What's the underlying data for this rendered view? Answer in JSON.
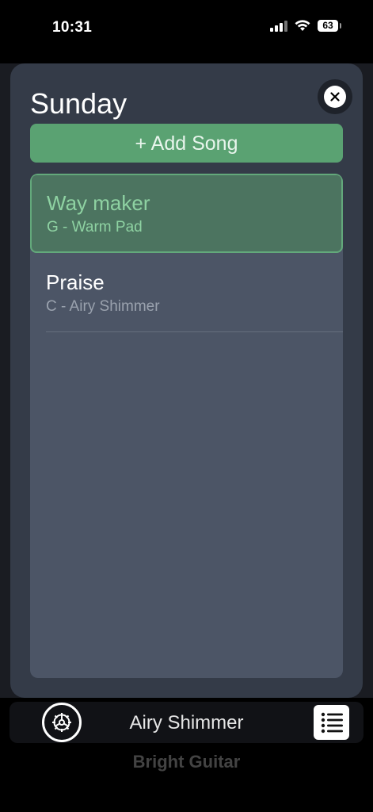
{
  "status_bar": {
    "time": "10:31",
    "battery": "63"
  },
  "sheet": {
    "title": "Sunday",
    "add_song_label": "+ Add Song",
    "songs": [
      {
        "name": "Way maker",
        "detail": "G - Warm Pad",
        "selected": true
      },
      {
        "name": "Praise",
        "detail": "C - Airy Shimmer",
        "selected": false
      }
    ]
  },
  "bottom_bar": {
    "current_patch": "Airy Shimmer",
    "next_patch": "Bright Guitar"
  },
  "icons": {
    "close": "close-icon",
    "settings": "gear-icon",
    "list": "list-icon",
    "signal": "signal-icon",
    "wifi": "wifi-icon",
    "battery": "battery-icon"
  },
  "colors": {
    "accent_green": "#5aa272",
    "selected_text": "#8ed2a2",
    "sheet_bg": "#343b48",
    "list_bg": "#4c5566"
  }
}
